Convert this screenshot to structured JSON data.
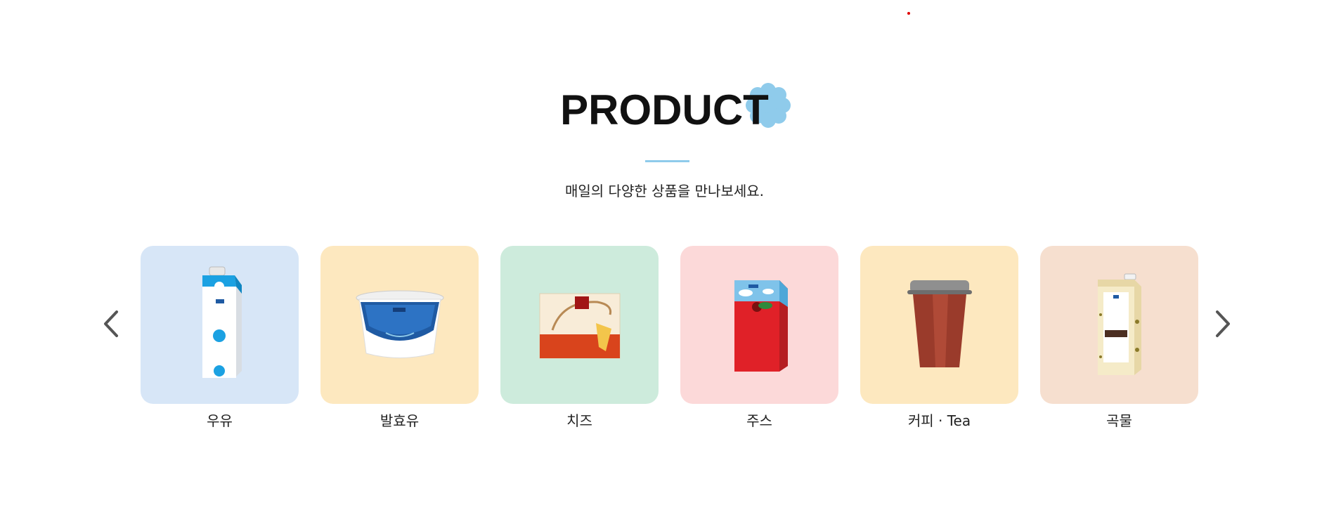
{
  "header": {
    "title": "PRODUCT",
    "subtitle": "매일의 다양한 상품을 만나보세요.",
    "accent_color": "#8fcbeb"
  },
  "carousel": {
    "prev_icon": "chevron-left-icon",
    "next_icon": "chevron-right-icon",
    "items": [
      {
        "label": "우유",
        "bg": "#d7e6f7",
        "icon": "milk-carton-icon"
      },
      {
        "label": "발효유",
        "bg": "#fde8bf",
        "icon": "yogurt-cup-icon"
      },
      {
        "label": "치즈",
        "bg": "#cdebdc",
        "icon": "cheese-pack-icon"
      },
      {
        "label": "주스",
        "bg": "#fcd9d9",
        "icon": "juice-box-icon"
      },
      {
        "label": "커피 · Tea",
        "bg": "#fde8bf",
        "icon": "coffee-cup-icon"
      },
      {
        "label": "곡물",
        "bg": "#f6dfcf",
        "icon": "grain-carton-icon"
      }
    ]
  }
}
